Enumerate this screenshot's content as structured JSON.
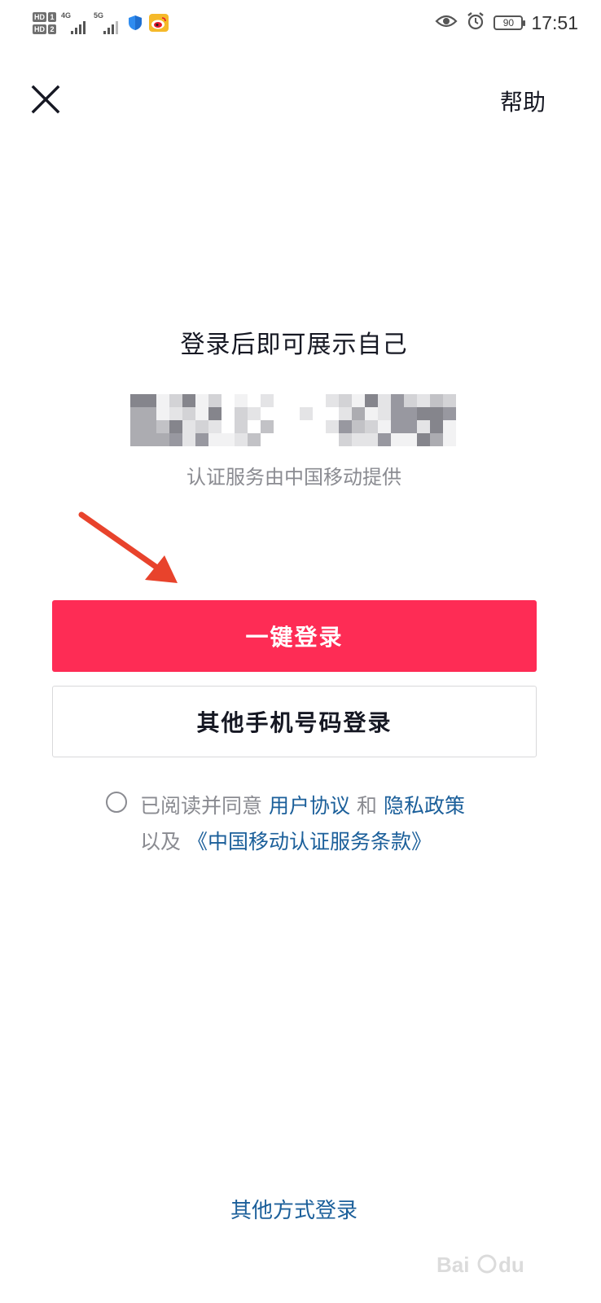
{
  "status_bar": {
    "hd1_tag": "HD",
    "hd1_num": "1",
    "hd2_tag": "HD",
    "hd2_num": "2",
    "sim1_network": "4G",
    "sim2_network": "5G",
    "battery_level": "90",
    "time": "17:51",
    "icons": [
      "eye-icon",
      "alarm-clock-icon",
      "shield-icon",
      "weibo-icon"
    ]
  },
  "top_bar": {
    "close_icon": "close-icon",
    "help_label": "帮助"
  },
  "main": {
    "headline": "登录后即可展示自己",
    "masked_phone_note": "pixelated phone number",
    "provider_text": "认证服务由中国移动提供",
    "one_click_login_label": "一键登录",
    "other_phone_login_label": "其他手机号码登录"
  },
  "agreement": {
    "prefix": "已阅读并同意",
    "user_agreement": "用户协议",
    "and": "和",
    "privacy_policy": "隐私政策",
    "also": "以及",
    "cmcc_terms": "《中国移动认证服务条款》"
  },
  "footer": {
    "other_methods_label": "其他方式登录"
  },
  "colors": {
    "primary": "#fe2c55",
    "link": "#1b5f9a",
    "muted_text": "#8a8b91",
    "annotation_arrow": "#e8432c"
  }
}
